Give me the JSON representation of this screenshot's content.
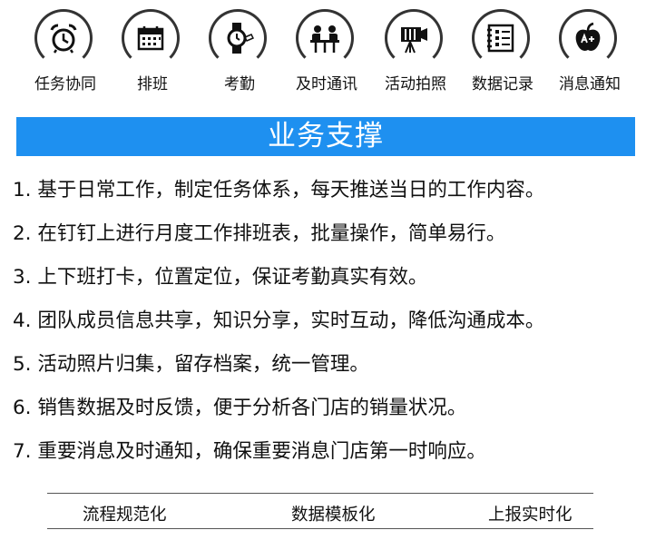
{
  "features": [
    {
      "label": "任务协同",
      "icon": "alarm-clock-icon"
    },
    {
      "label": "排班",
      "icon": "calendar-icon"
    },
    {
      "label": "考勤",
      "icon": "watch-icon"
    },
    {
      "label": "及时通讯",
      "icon": "meeting-icon"
    },
    {
      "label": "活动拍照",
      "icon": "camera-icon"
    },
    {
      "label": "数据记录",
      "icon": "notebook-icon"
    },
    {
      "label": "消息通知",
      "icon": "apple-icon"
    }
  ],
  "banner": {
    "title": "业务支撑"
  },
  "items": [
    "1. 基于日常工作，制定任务体系，每天推送当日的工作内容。",
    "2. 在钉钉上进行月度工作排班表，批量操作，简单易行。",
    "3. 上下班打卡，位置定位，保证考勤真实有效。",
    "4. 团队成员信息共享，知识分享，实时互动，降低沟通成本。",
    "5. 活动照片归集，留存档案，统一管理。",
    "6. 销售数据及时反馈，便于分析各门店的销量状况。",
    "7. 重要消息及时通知，确保重要消息门店第一时响应。"
  ],
  "footer": [
    "流程规范化",
    "数据模板化",
    "上报实时化"
  ],
  "colors": {
    "banner": "#1e90f0",
    "ring": "#333333"
  }
}
